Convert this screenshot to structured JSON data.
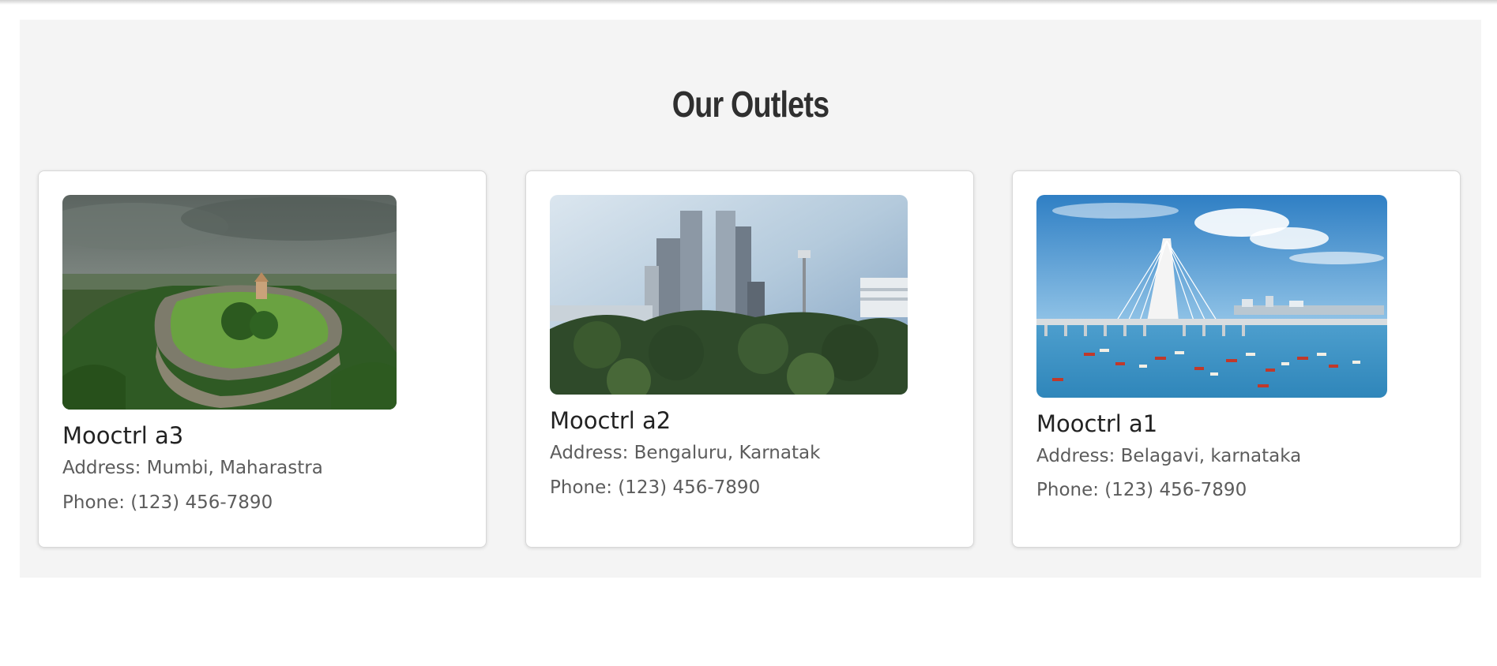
{
  "section": {
    "title": "Our Outlets"
  },
  "outlets": [
    {
      "name": "Mooctrl a3",
      "address": "Address: Mumbi, Maharastra",
      "phone": "Phone: (123) 456-7890",
      "image_subject": "hill-fort-aerial-photo"
    },
    {
      "name": "Mooctrl a2",
      "address": "Address: Bengaluru, Karnatak",
      "phone": "Phone: (123) 456-7890",
      "image_subject": "city-skyline-photo"
    },
    {
      "name": "Mooctrl a1",
      "address": "Address: Belagavi, karnataka",
      "phone": "Phone: (123) 456-7890",
      "image_subject": "sea-link-bridge-photo"
    }
  ],
  "colors": {
    "section_background": "#f4f4f4",
    "card_background": "#ffffff",
    "title_text": "#2f2f2f",
    "name_text": "#222222",
    "detail_text": "#5c5c5c"
  }
}
